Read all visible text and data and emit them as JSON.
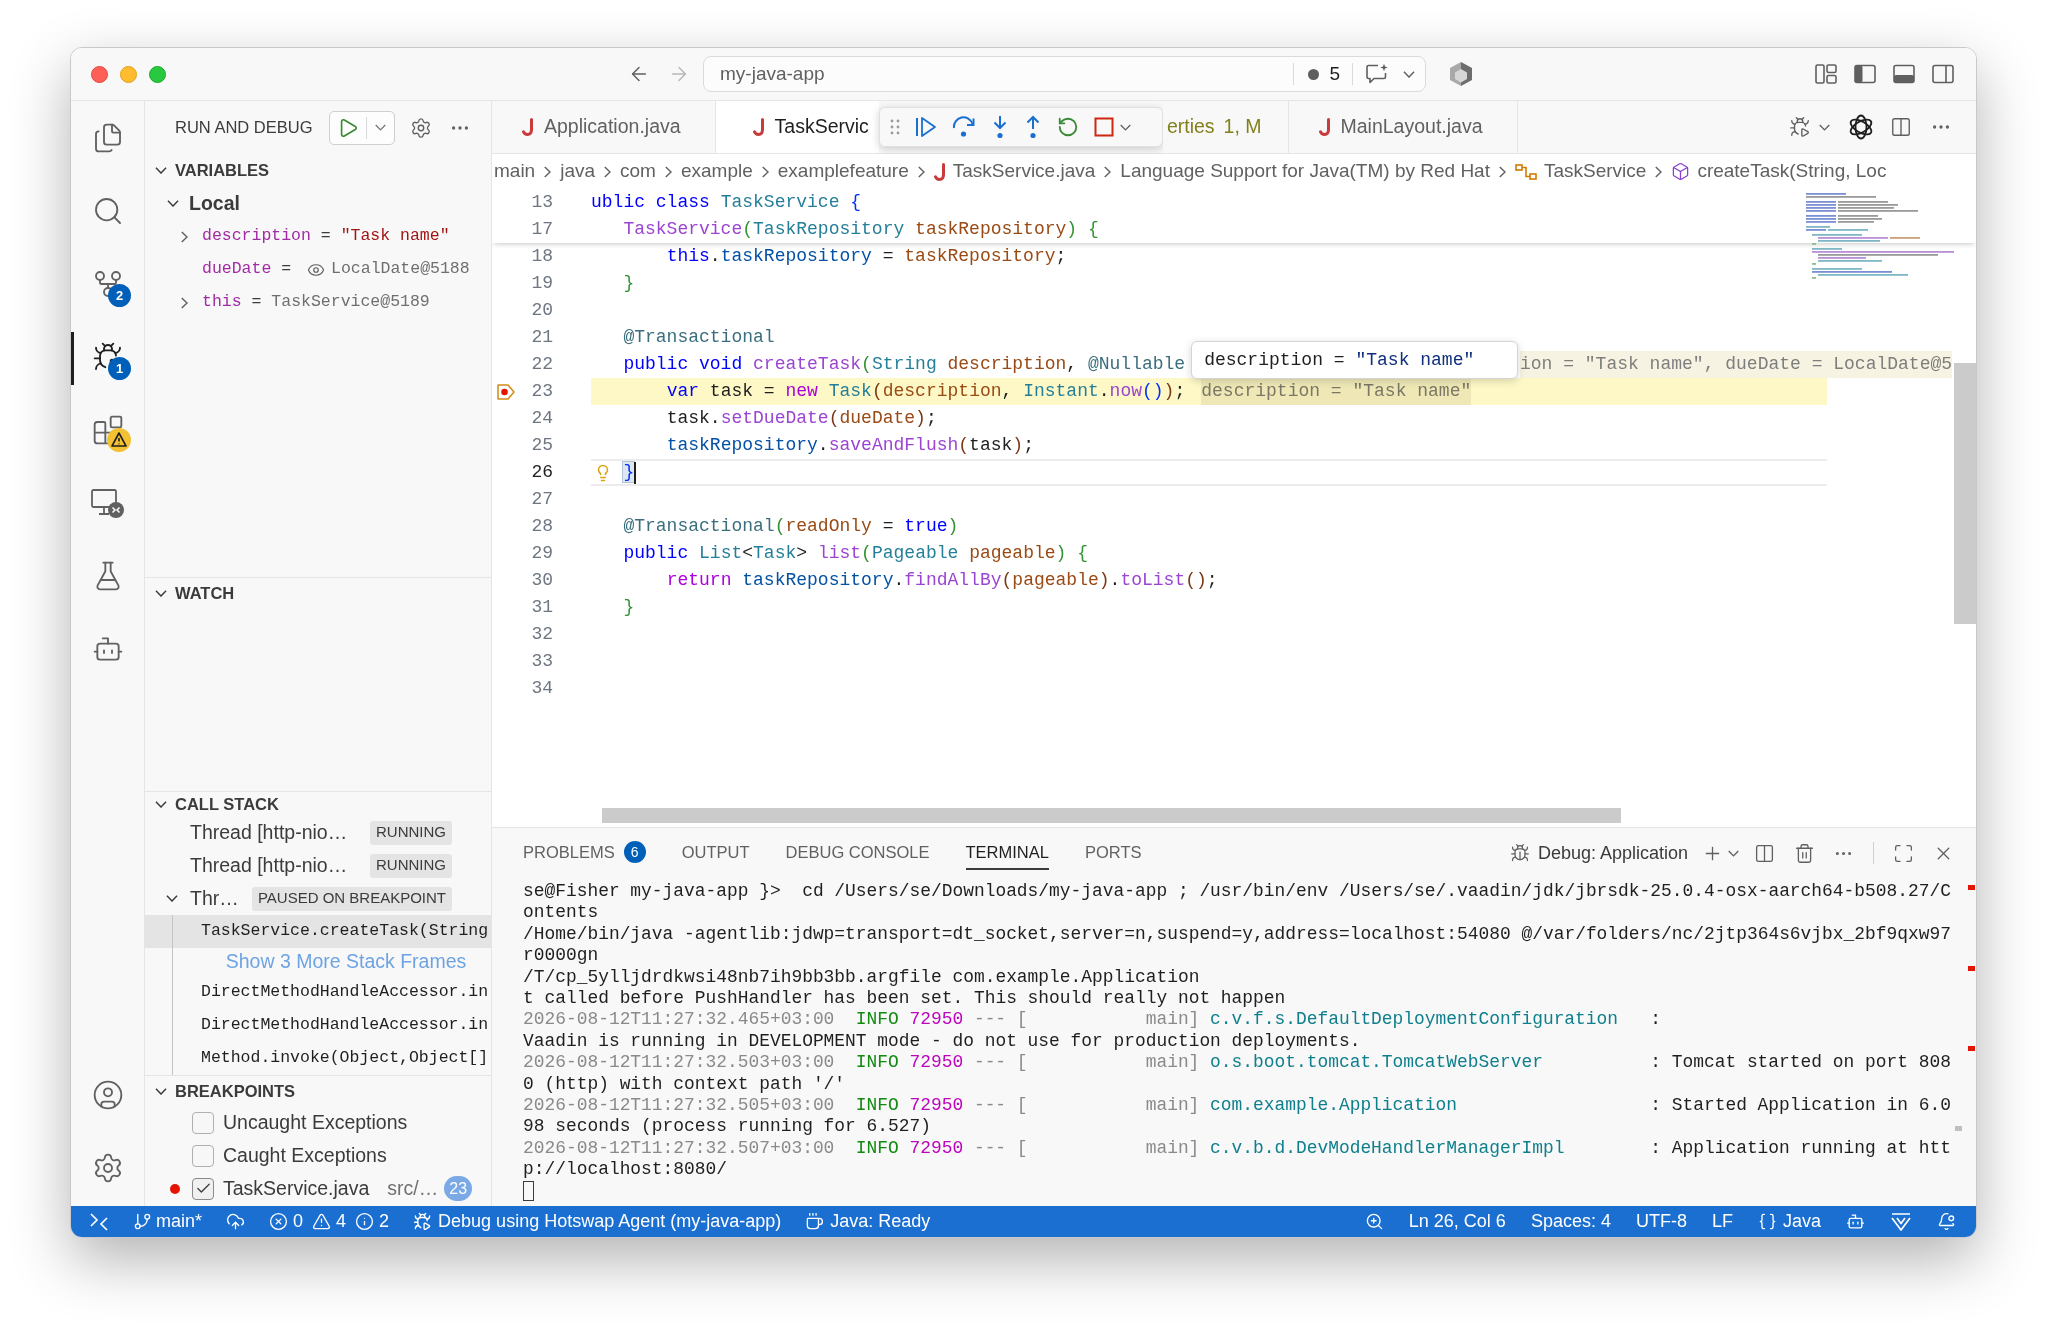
{
  "title_bar": {
    "navigation": [
      {
        "kind": "back",
        "disabled": false
      },
      {
        "kind": "forward",
        "disabled": true
      }
    ],
    "command_center": {
      "label": "my-java-app",
      "count": "5"
    }
  },
  "activity_bar": {
    "items": [
      {
        "kind": "explorer",
        "selected": false
      },
      {
        "kind": "search",
        "selected": false
      },
      {
        "kind": "source-control",
        "selected": false,
        "badge": {
          "kind": "count",
          "text": "2"
        }
      },
      {
        "kind": "run-debug",
        "selected": true,
        "badge": {
          "kind": "count",
          "text": "1"
        }
      },
      {
        "kind": "extensions",
        "selected": false,
        "badge": {
          "kind": "warning"
        }
      },
      {
        "kind": "remote",
        "selected": false
      },
      {
        "kind": "testing",
        "selected": false
      },
      {
        "kind": "assistant",
        "selected": false
      }
    ],
    "bottom_items": [
      {
        "kind": "account"
      },
      {
        "kind": "settings"
      }
    ]
  },
  "sidebar": {
    "title": "RUN AND DEBUG",
    "variables": {
      "title": "VARIABLES",
      "expanded": true,
      "scopes": [
        {
          "label": "Local",
          "expanded": true,
          "items": [
            {
              "name": "description",
              "operator": "=",
              "value": "\"Task name\"",
              "kind": "string",
              "expandable": true
            },
            {
              "name": "dueDate",
              "operator": "=",
              "value": "LocalDate@5188",
              "kind": "lazy",
              "expandable": false
            },
            {
              "name": "this",
              "operator": "=",
              "value": "TaskService@5189",
              "kind": "object",
              "expandable": true
            }
          ]
        }
      ]
    },
    "watch": {
      "title": "WATCH",
      "expanded": true
    },
    "call_stack": {
      "title": "CALL STACK",
      "expanded": true,
      "threads": [
        {
          "label": "Thread [http-nio…",
          "status": "RUNNING"
        },
        {
          "label": "Thread [http-nio…",
          "status": "RUNNING"
        },
        {
          "label": "Thr…",
          "status": "PAUSED ON BREAKPOINT",
          "frames": [
            {
              "label": "TaskService.createTask(String",
              "kind": "frame",
              "selected": true
            },
            {
              "label": "Show 3 More Stack Frames",
              "kind": "link",
              "selected": false
            },
            {
              "label": "DirectMethodHandleAccessor.in",
              "kind": "frame",
              "selected": false
            },
            {
              "label": "DirectMethodHandleAccessor.in",
              "kind": "frame",
              "selected": false
            },
            {
              "label": "Method.invoke(Object,Object[]",
              "kind": "frame",
              "selected": false
            }
          ]
        }
      ]
    },
    "breakpoints": {
      "title": "BREAKPOINTS",
      "expanded": true,
      "items": [
        {
          "label": "Uncaught Exceptions",
          "kind": "exception",
          "checked": false
        },
        {
          "label": "Caught Exceptions",
          "kind": "exception",
          "checked": false
        },
        {
          "label": "TaskService.java",
          "kind": "source",
          "checked": true,
          "path": "src/…",
          "line": "23"
        }
      ]
    }
  },
  "editor": {
    "tabs": [
      {
        "label": "Application.java",
        "kind": "java",
        "selected": false,
        "modified": false
      },
      {
        "label": "TaskServic",
        "kind": "java",
        "selected": true,
        "modified": false
      },
      {
        "label": "erties",
        "kind": "covered",
        "selected": false,
        "modified": true,
        "badge": "1, M"
      },
      {
        "label": "MainLayout.java",
        "kind": "java",
        "selected": false,
        "modified": false
      }
    ],
    "breadcrumbs": [
      {
        "label": "main",
        "kind": "plain"
      },
      {
        "label": "java",
        "kind": "plain"
      },
      {
        "label": "com",
        "kind": "plain"
      },
      {
        "label": "example",
        "kind": "plain"
      },
      {
        "label": "examplefeature",
        "kind": "plain"
      },
      {
        "label": "TaskService.java",
        "kind": "java-file"
      },
      {
        "label": "Language Support for Java(TM) by Red Hat",
        "kind": "plain"
      },
      {
        "label": "TaskService",
        "kind": "class"
      },
      {
        "label": "createTask(String, Loc",
        "kind": "method"
      }
    ],
    "sticky_lines": [
      {
        "number": "13",
        "kind": "code",
        "tokens": [
          {
            "text": "ublic class ",
            "kind": "keyword"
          },
          {
            "text": "TaskService",
            "kind": "type"
          },
          {
            "text": " {",
            "kind": "bracket-1"
          }
        ]
      },
      {
        "number": "17",
        "kind": "code",
        "tokens": [
          {
            "text": "   TaskService",
            "kind": "method"
          },
          {
            "text": "(",
            "kind": "bracket-2"
          },
          {
            "text": "TaskRepository ",
            "kind": "type"
          },
          {
            "text": "taskRepository",
            "kind": "param"
          },
          {
            "text": ") {",
            "kind": "bracket-2"
          }
        ]
      }
    ],
    "lines": [
      {
        "number": "18",
        "kind": "code",
        "tokens": [
          {
            "text": "       this",
            "kind": "keyword"
          },
          {
            "text": ".",
            "kind": "plain"
          },
          {
            "text": "taskRepository",
            "kind": "field"
          },
          {
            "text": " = ",
            "kind": "plain"
          },
          {
            "text": "taskRepository",
            "kind": "param"
          },
          {
            "text": ";",
            "kind": "plain"
          }
        ]
      },
      {
        "number": "19",
        "kind": "code",
        "tokens": [
          {
            "text": "   }",
            "kind": "bracket-2"
          }
        ]
      },
      {
        "number": "20",
        "kind": "code"
      },
      {
        "number": "21",
        "kind": "code",
        "tokens": [
          {
            "text": "   @Transactional",
            "kind": "annotation"
          }
        ]
      },
      {
        "number": "22",
        "kind": "code",
        "tokens": [
          {
            "text": "   public void ",
            "kind": "keyword"
          },
          {
            "text": "createTask",
            "kind": "method"
          },
          {
            "text": "(",
            "kind": "bracket-2"
          },
          {
            "text": "String ",
            "kind": "type"
          },
          {
            "text": "description",
            "kind": "param"
          },
          {
            "text": ", ",
            "kind": "plain"
          },
          {
            "text": "@Nullable",
            "kind": "annotation"
          }
        ],
        "hover": {
          "name": "description",
          "operator": "=",
          "value": "\"Task name\""
        },
        "inline_value": "ion = \"Task name\", dueDate = LocalDate@5"
      },
      {
        "number": "23",
        "kind": "stopped",
        "tokens": [
          {
            "text": "       var ",
            "kind": "keyword"
          },
          {
            "text": "task = ",
            "kind": "plain"
          },
          {
            "text": "new ",
            "kind": "control"
          },
          {
            "text": "Task",
            "kind": "type"
          },
          {
            "text": "(",
            "kind": "bracket-3"
          },
          {
            "text": "description",
            "kind": "param"
          },
          {
            "text": ", ",
            "kind": "plain"
          },
          {
            "text": "Instant",
            "kind": "type"
          },
          {
            "text": ".",
            "kind": "plain"
          },
          {
            "text": "now",
            "kind": "method"
          },
          {
            "text": "()",
            "kind": "bracket-1"
          },
          {
            "text": ")",
            "kind": "bracket-3"
          },
          {
            "text": ";",
            "kind": "plain"
          }
        ],
        "inline_value": "description = \"Task name\""
      },
      {
        "number": "24",
        "kind": "code",
        "tokens": [
          {
            "text": "       task.",
            "kind": "plain"
          },
          {
            "text": "setDueDate",
            "kind": "method"
          },
          {
            "text": "(",
            "kind": "bracket-3"
          },
          {
            "text": "dueDate",
            "kind": "param"
          },
          {
            "text": ")",
            "kind": "bracket-3"
          },
          {
            "text": ";",
            "kind": "plain"
          }
        ]
      },
      {
        "number": "25",
        "kind": "code",
        "tokens": [
          {
            "text": "       taskRepository",
            "kind": "field"
          },
          {
            "text": ".",
            "kind": "plain"
          },
          {
            "text": "saveAndFlush",
            "kind": "method"
          },
          {
            "text": "(",
            "kind": "bracket-3"
          },
          {
            "text": "task",
            "kind": "plain"
          },
          {
            "text": ")",
            "kind": "bracket-3"
          },
          {
            "text": ";",
            "kind": "plain"
          }
        ]
      },
      {
        "number": "26",
        "kind": "current",
        "tokens": [
          {
            "text": "   }",
            "kind": "bracket-match"
          }
        ]
      },
      {
        "number": "27",
        "kind": "code"
      },
      {
        "number": "28",
        "kind": "code",
        "tokens": [
          {
            "text": "   @Transactional",
            "kind": "annotation"
          },
          {
            "text": "(",
            "kind": "bracket-2"
          },
          {
            "text": "readOnly",
            "kind": "param"
          },
          {
            "text": " = ",
            "kind": "plain"
          },
          {
            "text": "true",
            "kind": "keyword"
          },
          {
            "text": ")",
            "kind": "bracket-2"
          }
        ]
      },
      {
        "number": "29",
        "kind": "code",
        "tokens": [
          {
            "text": "   public ",
            "kind": "keyword"
          },
          {
            "text": "List",
            "kind": "type"
          },
          {
            "text": "<",
            "kind": "plain"
          },
          {
            "text": "Task",
            "kind": "type"
          },
          {
            "text": "> ",
            "kind": "plain"
          },
          {
            "text": "list",
            "kind": "method"
          },
          {
            "text": "(",
            "kind": "bracket-2"
          },
          {
            "text": "Pageable ",
            "kind": "type"
          },
          {
            "text": "pageable",
            "kind": "param"
          },
          {
            "text": ") {",
            "kind": "bracket-2"
          }
        ]
      },
      {
        "number": "30",
        "kind": "code",
        "tokens": [
          {
            "text": "       return ",
            "kind": "control"
          },
          {
            "text": "taskRepository",
            "kind": "field"
          },
          {
            "text": ".",
            "kind": "plain"
          },
          {
            "text": "findAllBy",
            "kind": "method"
          },
          {
            "text": "(",
            "kind": "bracket-3"
          },
          {
            "text": "pageable",
            "kind": "param"
          },
          {
            "text": ")",
            "kind": "bracket-3"
          },
          {
            "text": ".",
            "kind": "plain"
          },
          {
            "text": "toList",
            "kind": "method"
          },
          {
            "text": "()",
            "kind": "bracket-3"
          },
          {
            "text": ";",
            "kind": "plain"
          }
        ]
      },
      {
        "number": "31",
        "kind": "code",
        "tokens": [
          {
            "text": "   }",
            "kind": "bracket-2"
          }
        ]
      },
      {
        "number": "32",
        "kind": "code"
      },
      {
        "number": "33",
        "kind": "code"
      },
      {
        "number": "34",
        "kind": "code"
      }
    ]
  },
  "panel": {
    "tabs": [
      {
        "label": "PROBLEMS",
        "selected": false,
        "badge": "6"
      },
      {
        "label": "OUTPUT",
        "selected": false
      },
      {
        "label": "DEBUG CONSOLE",
        "selected": false
      },
      {
        "label": "TERMINAL",
        "selected": true
      },
      {
        "label": "PORTS",
        "selected": false
      }
    ],
    "terminal_name": "Debug: Application",
    "rows": [
      {
        "kind": "text",
        "text": "se@Fisher my-java-app }>  cd /Users/se/Downloads/my-java-app ; /usr/bin/env /Users/se/.vaadin/jdk/jbrsdk-25.0.4-osx-aarch64-b508.27/C"
      },
      {
        "kind": "text",
        "text": "ontents"
      },
      {
        "kind": "text",
        "text": "/Home/bin/java -agentlib:jdwp=transport=dt_socket,server=n,suspend=y,address=localhost:54080 @/var/folders/nc/2jtp364s6vjbx_2bf9qxw97"
      },
      {
        "kind": "text",
        "text": "r0000gn"
      },
      {
        "kind": "text",
        "text": "/T/cp_5ylljdrdkwsi48nb7ih9bb3bb.argfile com.example.Application"
      },
      {
        "kind": "text",
        "text": "t called before PushHandler has been set. This should really not happen"
      },
      {
        "kind": "log",
        "time": "2026-08-12T11:27:32.465+03:00",
        "level": "INFO",
        "pid": "72950",
        "thread": "--- [           main]",
        "logger": "c.v.f.s.DefaultDeploymentConfiguration",
        "message": ":"
      },
      {
        "kind": "text",
        "text": "Vaadin is running in DEVELOPMENT mode - do not use for production deployments."
      },
      {
        "kind": "log",
        "time": "2026-08-12T11:27:32.503+03:00",
        "level": "INFO",
        "pid": "72950",
        "thread": "--- [           main]",
        "logger": "o.s.boot.tomcat.TomcatWebServer",
        "message": ": Tomcat started on port 808"
      },
      {
        "kind": "text",
        "text": "0 (http) with context path '/'"
      },
      {
        "kind": "log",
        "time": "2026-08-12T11:27:32.505+03:00",
        "level": "INFO",
        "pid": "72950",
        "thread": "--- [           main]",
        "logger": "com.example.Application",
        "message": ": Started Application in 6.0"
      },
      {
        "kind": "text",
        "text": "98 seconds (process running for 6.527)"
      },
      {
        "kind": "log",
        "time": "2026-08-12T11:27:32.507+03:00",
        "level": "INFO",
        "pid": "72950",
        "thread": "--- [           main]",
        "logger": "c.v.b.d.DevModeHandlerManagerImpl",
        "message": ": Application running at htt"
      },
      {
        "kind": "text",
        "text": "p://localhost:8080/"
      },
      {
        "kind": "cursor"
      }
    ]
  },
  "status_bar": {
    "left": [
      {
        "kind": "remote"
      },
      {
        "kind": "branch",
        "label": "main*"
      },
      {
        "kind": "publish"
      },
      {
        "kind": "problems",
        "errors": "0",
        "warnings": "4",
        "infos": "2"
      },
      {
        "kind": "debug",
        "label": "Debug using Hotswap Agent (my-java-app)"
      },
      {
        "kind": "java",
        "label": "Java: Ready"
      }
    ],
    "right": [
      {
        "kind": "zoom"
      },
      {
        "kind": "text",
        "label": "Ln 26, Col 6"
      },
      {
        "kind": "text",
        "label": "Spaces: 4"
      },
      {
        "kind": "text",
        "label": "UTF-8"
      },
      {
        "kind": "text",
        "label": "LF"
      },
      {
        "kind": "language",
        "label": "Java"
      },
      {
        "kind": "assistant"
      },
      {
        "kind": "extension"
      },
      {
        "kind": "notifications"
      }
    ]
  }
}
